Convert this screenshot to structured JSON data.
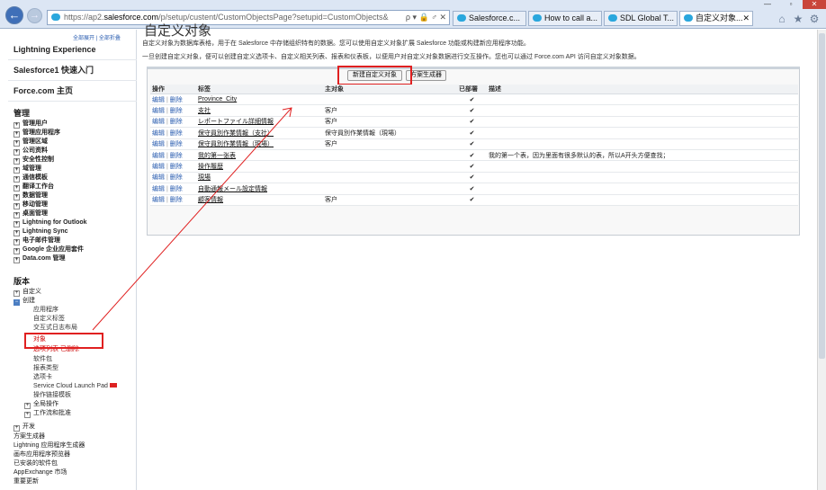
{
  "browser": {
    "address_domain_prefix": "https://ap2.",
    "address_domain": "salesforce.com",
    "address_path": "/p/setup/custent/CustomObjectsPage?setupid=CustomObjects&",
    "address_icons": "ρ ▾ 🔒 ♂ ✕",
    "back_symbol": "←",
    "forward_symbol": "→",
    "tabs": [
      {
        "label": "Salesforce.c..."
      },
      {
        "label": "How to call a..."
      },
      {
        "label": "SDL Global T..."
      },
      {
        "label": "自定义对象..."
      }
    ],
    "tab_close": "✕",
    "window_minimize": "—",
    "window_maximize": "▫",
    "window_close": "✕",
    "tool_icons": [
      "⌂",
      "★",
      "⚙"
    ]
  },
  "sidebar": {
    "expand_all": "全部展开",
    "collapse_all": "全部折叠",
    "sections": [
      "Lightning Experience",
      "Salesforce1 快速入门",
      "Force.com 主页"
    ],
    "admin_header": "管理",
    "admin_items": [
      "管理用户",
      "管理应用程序",
      "管理区域",
      "公司资料",
      "安全性控制",
      "域管理",
      "通信模板",
      "翻译工作台",
      "数据管理",
      "移动管理",
      "桌面管理",
      "Lightning for Outlook",
      "Lightning Sync",
      "电子邮件管理",
      "Google 企业应用套件",
      "Data.com 管理"
    ],
    "build_header": "版本",
    "build_items": [
      "自定义",
      "创建"
    ],
    "create_subitems": [
      "应用程序",
      "自定义标签",
      "交互式日志布局"
    ],
    "objects_item": "对象",
    "objects_popup": "选项列表 已删除",
    "create_subitems2": [
      "软件包",
      "报表类型",
      "选项卡",
      "Service Cloud Launch Pad"
    ],
    "create_subitems3": [
      "操作链接模板"
    ],
    "expand_items": [
      "全局操作",
      "工作流和批准"
    ],
    "develop_item": "开发",
    "bottom_items": [
      "方案生成器",
      "Lightning 应用程序生成器",
      "画布应用程序预览器",
      "已安装的软件包",
      "AppExchange 市场",
      "重要更新"
    ]
  },
  "main": {
    "title": "自定义对象",
    "intro_1": "自定义对象为数据库表格，用于在 Salesforce 中存储组织特有的数据。您可以使用自定义对象扩展 Salesforce 功能或构建新应用程序功能。",
    "intro_2": "一旦创建自定义对象，便可以创建自定义选项卡、自定义相关列表、报表和仪表板，以便用户对自定义对象数据进行交互操作。您也可以通过 Force.com API 访问自定义对象数据。",
    "new_button": "新建自定义对象",
    "schema_button": "方案生成器",
    "columns": [
      "操作",
      "标签",
      "主对象",
      "已部署",
      "描述"
    ],
    "edit_label": "编辑",
    "delete_label": "删除",
    "separator": "|",
    "check_symbol": "✔",
    "rows": [
      {
        "label": "Province_City",
        "master": "",
        "deployed": true,
        "description": ""
      },
      {
        "label": "支社",
        "master": "客户",
        "deployed": true,
        "description": ""
      },
      {
        "label": "レポートファイル詳細情報",
        "master": "客户",
        "deployed": true,
        "description": ""
      },
      {
        "label": "保守員別作業情報（支社）",
        "master": "保守員別作業情報（現場）",
        "deployed": true,
        "description": ""
      },
      {
        "label": "保守員別作業情報（現場）",
        "master": "客户",
        "deployed": true,
        "description": ""
      },
      {
        "label": "我的第一张表",
        "master": "",
        "deployed": true,
        "description": "我的第一个表，因为里面有很多默认的表，所以A开头方便查找；"
      },
      {
        "label": "操作履歴",
        "master": "",
        "deployed": true,
        "description": ""
      },
      {
        "label": "現場",
        "master": "",
        "deployed": true,
        "description": ""
      },
      {
        "label": "自動通報メール設定情報",
        "master": "",
        "deployed": true,
        "description": ""
      },
      {
        "label": "顧客情報",
        "master": "客户",
        "deployed": true,
        "description": ""
      }
    ]
  },
  "colors": {
    "highlight": "#e02020",
    "link": "#2a5db0",
    "chrome": "#dce6f4"
  }
}
